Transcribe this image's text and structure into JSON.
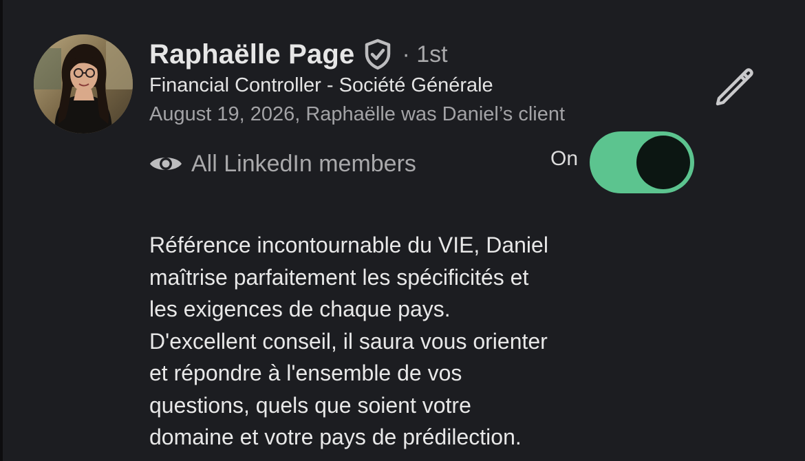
{
  "recommendation": {
    "name": "Raphaëlle Page",
    "verified_icon": "shield-check-icon",
    "degree": "· 1st",
    "headline": "Financial Controller - Société Générale",
    "meta": "August 19, 2026, Raphaëlle was Daniel’s client",
    "edit_icon": "pencil-icon",
    "visibility": {
      "icon": "eye-icon",
      "label": "All LinkedIn members"
    },
    "toggle": {
      "label": "On",
      "state": "on",
      "color": "#5cc48f"
    },
    "text_lines": [
      "Référence incontournable du VIE, Daniel",
      "maîtrise parfaitement les spécificités et",
      "les exigences de chaque pays.",
      "D'excellent conseil, il saura vous orienter",
      "et répondre à l'ensemble de vos",
      "questions, quels que soient votre",
      "domaine et votre pays de prédilection."
    ]
  },
  "colors": {
    "background": "#1c1d21",
    "accent": "#5cc48f",
    "text_primary": "#e6e6e6",
    "text_secondary": "#a3a3a6"
  }
}
